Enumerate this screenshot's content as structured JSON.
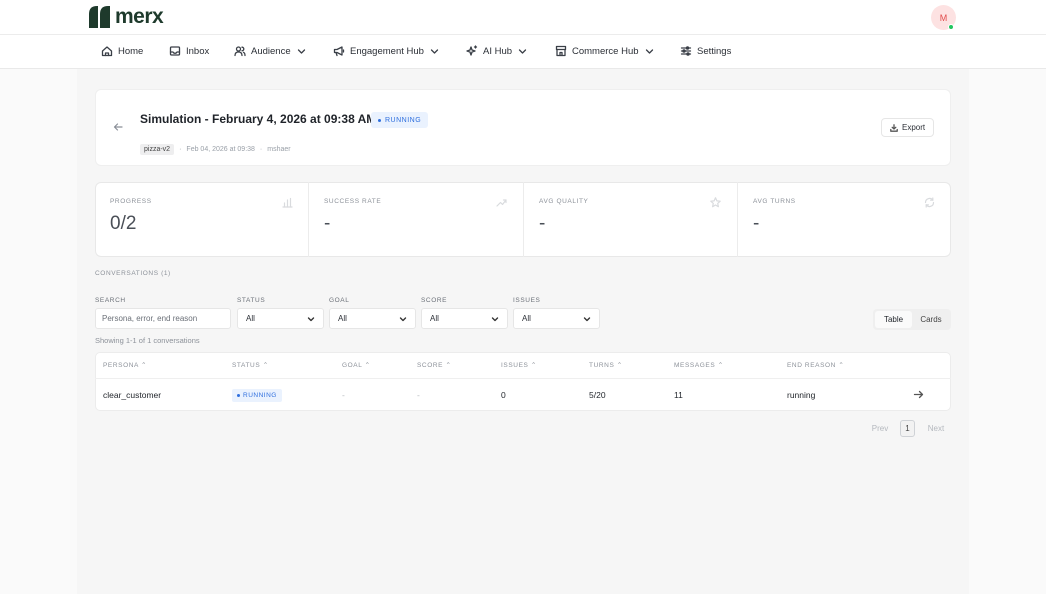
{
  "brand": {
    "name": "merx",
    "color": "#1e3a2c"
  },
  "user": {
    "initial": "M",
    "status_color": "#22c55e"
  },
  "nav": {
    "items": [
      {
        "label": "Home",
        "icon": "home-icon"
      },
      {
        "label": "Inbox",
        "icon": "inbox-icon"
      },
      {
        "label": "Audience",
        "icon": "users-icon",
        "dropdown": true
      },
      {
        "label": "Engagement Hub",
        "icon": "megaphone-icon",
        "dropdown": true
      },
      {
        "label": "AI Hub",
        "icon": "sparkles-icon",
        "dropdown": true
      },
      {
        "label": "Commerce Hub",
        "icon": "store-icon",
        "dropdown": true
      },
      {
        "label": "Settings",
        "icon": "sliders-icon"
      }
    ]
  },
  "simulation": {
    "title": "Simulation - February 4, 2026 at 09:38 AM",
    "status": "RUNNING",
    "tag": "pizza-v2",
    "date": "Feb 04, 2026 at 09:38",
    "author": "mshaer",
    "export_label": "Export"
  },
  "stats": [
    {
      "label": "PROGRESS",
      "value": "0/2",
      "icon": "bar-chart-icon"
    },
    {
      "label": "SUCCESS RATE",
      "value": "-",
      "icon": "trend-icon"
    },
    {
      "label": "AVG QUALITY",
      "value": "-",
      "icon": "star-icon"
    },
    {
      "label": "AVG TURNS",
      "value": "-",
      "icon": "refresh-icon"
    }
  ],
  "conversations": {
    "title": "CONVERSATIONS (1)",
    "filters": {
      "search_label": "SEARCH",
      "search_placeholder": "Persona, error, end reason",
      "status_label": "STATUS",
      "status_value": "All",
      "goal_label": "GOAL",
      "goal_value": "All",
      "score_label": "SCORE",
      "score_value": "All",
      "issues_label": "ISSUES",
      "issues_value": "All"
    },
    "view_options": [
      "Table",
      "Cards"
    ],
    "active_view": "Table",
    "showing": "Showing 1-1 of 1 conversations",
    "columns": [
      "PERSONA",
      "STATUS",
      "GOAL",
      "SCORE",
      "ISSUES",
      "TURNS",
      "MESSAGES",
      "END REASON"
    ],
    "sort_glyph": "⌃",
    "rows": [
      {
        "persona": "clear_customer",
        "status": "RUNNING",
        "goal": "-",
        "score": "-",
        "issues": "0",
        "turns": "5/20",
        "messages": "11",
        "end_reason": "running"
      }
    ]
  },
  "pagination": {
    "prev": "Prev",
    "page": "1",
    "next": "Next"
  },
  "colors": {
    "accent_blue": "#2f6fde",
    "badge_bg": "#eaf2fe",
    "avatar_bg": "#fde2e2",
    "avatar_text": "#e14b4b"
  }
}
